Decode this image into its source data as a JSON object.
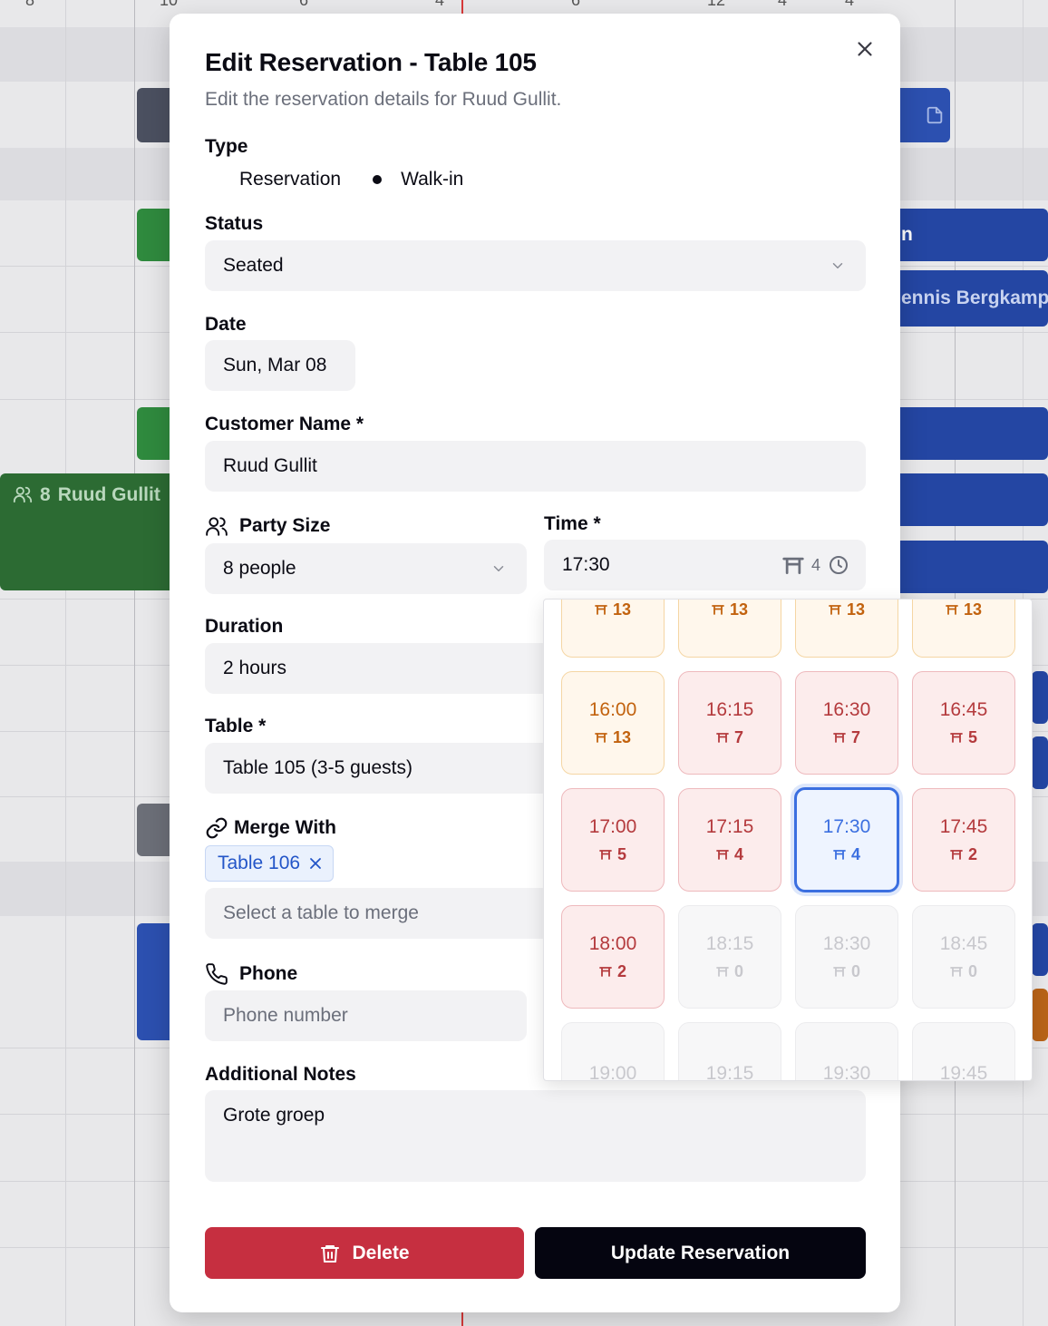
{
  "background": {
    "ticks": [
      "8",
      "10",
      "6",
      "4",
      "6",
      "12",
      "4",
      "4"
    ],
    "blocks": [
      {
        "id": "ruud",
        "party": "8",
        "name": "Ruud Gullit"
      },
      {
        "id": "bergkamp",
        "name": "ennis Bergkamp"
      },
      {
        "id": "b3",
        "name": "n"
      }
    ]
  },
  "modal": {
    "title": "Edit Reservation - Table 105",
    "subtitle": "Edit the reservation details for Ruud Gullit.",
    "close_icon": "x-icon",
    "type": {
      "label": "Type",
      "options": [
        {
          "label": "Reservation",
          "selected": false
        },
        {
          "label": "Walk-in",
          "selected": true
        }
      ]
    },
    "status": {
      "label": "Status",
      "value": "Seated"
    },
    "date": {
      "label": "Date",
      "value": "Sun, Mar 08"
    },
    "customer": {
      "label": "Customer Name *",
      "value": "Ruud Gullit"
    },
    "party": {
      "label": "Party Size",
      "value": "8 people",
      "icon": "users-icon"
    },
    "time": {
      "label": "Time *",
      "value": "17:30",
      "tables": "4",
      "icon": "clock-icon"
    },
    "duration": {
      "label": "Duration",
      "value": "2 hours"
    },
    "table": {
      "label": "Table *",
      "value": "Table 105 (3-5 guests)"
    },
    "merge": {
      "label": "Merge With",
      "chip": "Table 106",
      "placeholder": "Select a table to merge",
      "icon": "link-icon"
    },
    "phone": {
      "label": "Phone",
      "placeholder": "Phone number",
      "icon": "phone-icon"
    },
    "notes": {
      "label": "Additional Notes",
      "value": "Grote groep"
    },
    "delete_label": "Delete",
    "update_label": "Update Reservation"
  },
  "time_slots": [
    {
      "time": "",
      "avail": "13",
      "state": "amber"
    },
    {
      "time": "",
      "avail": "13",
      "state": "amber"
    },
    {
      "time": "",
      "avail": "13",
      "state": "amber"
    },
    {
      "time": "",
      "avail": "13",
      "state": "amber"
    },
    {
      "time": "16:00",
      "avail": "13",
      "state": "amber"
    },
    {
      "time": "16:15",
      "avail": "7",
      "state": "red"
    },
    {
      "time": "16:30",
      "avail": "7",
      "state": "red"
    },
    {
      "time": "16:45",
      "avail": "5",
      "state": "red"
    },
    {
      "time": "17:00",
      "avail": "5",
      "state": "red"
    },
    {
      "time": "17:15",
      "avail": "4",
      "state": "red"
    },
    {
      "time": "17:30",
      "avail": "4",
      "state": "selected"
    },
    {
      "time": "17:45",
      "avail": "2",
      "state": "red"
    },
    {
      "time": "18:00",
      "avail": "2",
      "state": "red"
    },
    {
      "time": "18:15",
      "avail": "0",
      "state": "disabled"
    },
    {
      "time": "18:30",
      "avail": "0",
      "state": "disabled"
    },
    {
      "time": "18:45",
      "avail": "0",
      "state": "disabled"
    },
    {
      "time": "19:00",
      "avail": "",
      "state": "disabled"
    },
    {
      "time": "19:15",
      "avail": "",
      "state": "disabled"
    },
    {
      "time": "19:30",
      "avail": "",
      "state": "disabled"
    },
    {
      "time": "19:45",
      "avail": "",
      "state": "disabled"
    }
  ],
  "colors": {
    "accent": "#3b6fe0",
    "danger": "#c62f40",
    "primary": "#050510"
  }
}
